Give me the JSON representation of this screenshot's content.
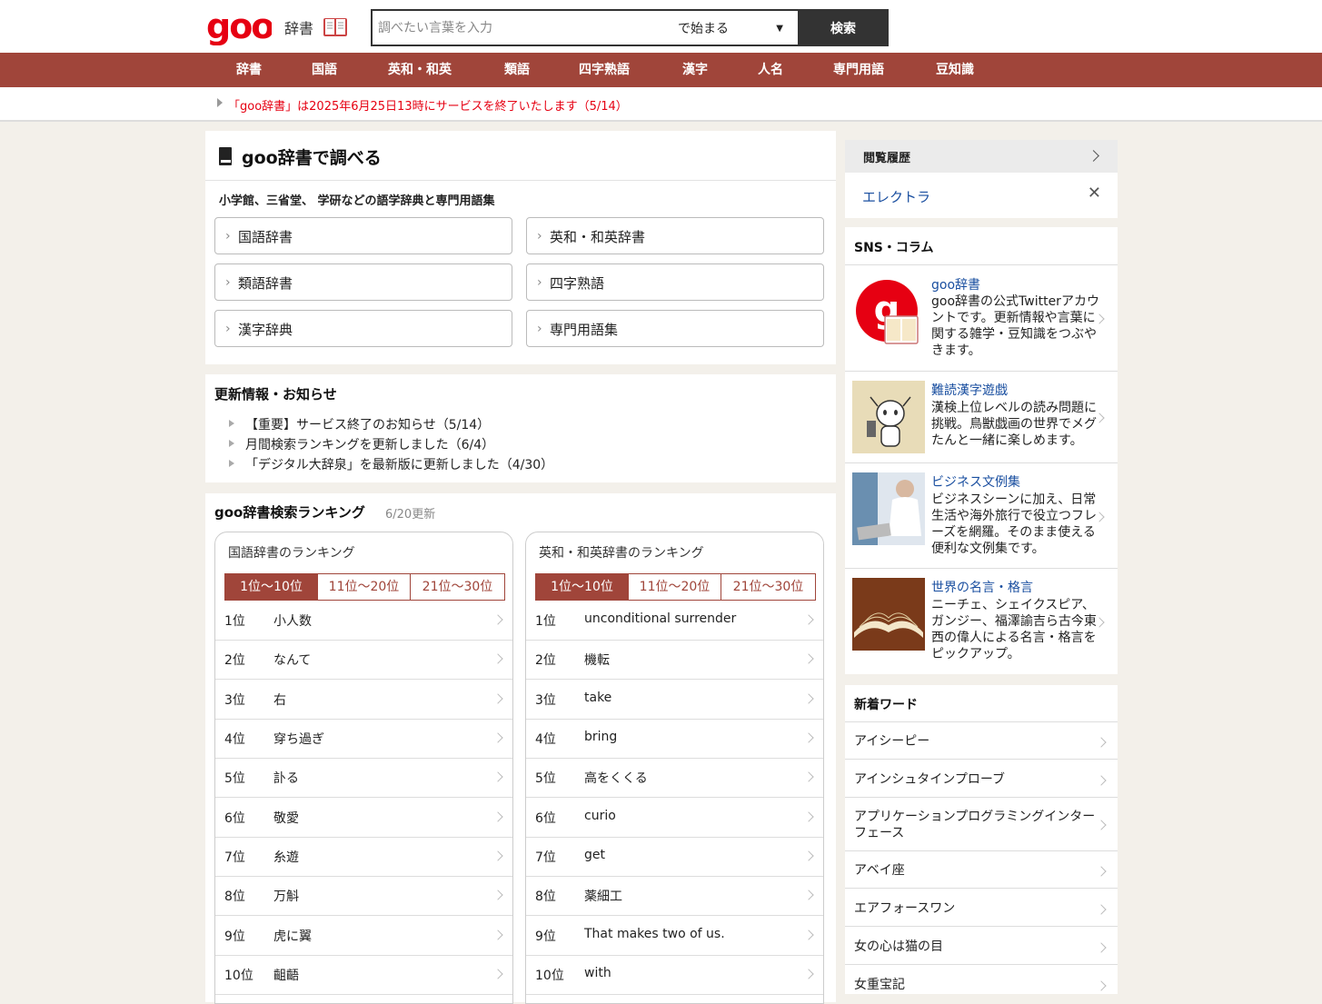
{
  "header": {
    "logo_text": "goo",
    "site_name": "辞書",
    "search": {
      "placeholder": "調べたい言葉を入力",
      "mode": "で始まる",
      "button": "検索"
    }
  },
  "nav": [
    "辞書",
    "国語",
    "英和・和英",
    "類語",
    "四字熟語",
    "漢字",
    "人名",
    "専門用語",
    "豆知識"
  ],
  "notice": "「goo辞書」は2025年6月25日13時にサービスを終了いたします（5/14）",
  "lookup": {
    "title": "goo辞書で調べる",
    "subtitle": "小学館、三省堂、 学研などの語学辞典と専門用語集",
    "dicts": [
      "国語辞書",
      "英和・和英辞書",
      "類語辞書",
      "四字熟語",
      "漢字辞典",
      "専門用語集"
    ]
  },
  "news": {
    "title": "更新情報・お知らせ",
    "items": [
      "【重要】サービス終了のお知らせ（5/14）",
      "月間検索ランキングを更新しました（6/4）",
      "「デジタル大辞泉」を最新版に更新しました（4/30）"
    ]
  },
  "ranking": {
    "title": "goo辞書検索ランキング",
    "updated": "6/20更新",
    "tabs": [
      "1位〜10位",
      "11位〜20位",
      "21位〜30位"
    ],
    "ranks": [
      "1位",
      "2位",
      "3位",
      "4位",
      "5位",
      "6位",
      "7位",
      "8位",
      "9位",
      "10位"
    ],
    "kokugo": {
      "title": "国語辞書のランキング",
      "words": [
        "小人数",
        "なんて",
        "右",
        "穿ち過ぎ",
        "訃る",
        "敬愛",
        "糸遊",
        "万斛",
        "虎に翼",
        "齟齬"
      ]
    },
    "eiwa": {
      "title": "英和・和英辞書のランキング",
      "words": [
        "unconditional surrender",
        "機転",
        "take",
        "bring",
        "高をくくる",
        "curio",
        "get",
        "薬細工",
        "That makes two of us.",
        "with"
      ]
    }
  },
  "sidebar": {
    "history_title": "閲覧履歴",
    "history_word": "エレクトラ",
    "history_close": "✕",
    "sns_title": "SNS・コラム",
    "sns": [
      {
        "name": "goo辞書",
        "desc": "goo辞書の公式Twitterアカウントです。更新情報や言葉に関する雑学・豆知識をつぶやきます。"
      },
      {
        "name": "難読漢字遊戯",
        "desc": "漢検上位レベルの読み問題に挑戦。鳥獣戯画の世界でメグたんと一緒に楽しめます。"
      },
      {
        "name": "ビジネス文例集",
        "desc": "ビジネスシーンに加え、日常生活や海外旅行で役立つフレーズを網羅。そのまま使える便利な文例集です。"
      },
      {
        "name": "世界の名言・格言",
        "desc": "ニーチェ、シェイクスピア、ガンジー、福澤諭吉ら古今東西の偉人による名言・格言をピックアップ。"
      }
    ],
    "new_words_title": "新着ワード",
    "new_words": [
      "アイシーピー",
      "アインシュタインプローブ",
      "アプリケーションプログラミングインターフェース",
      "アベイ座",
      "エアフォースワン",
      "女の心は猫の目",
      "女重宝記"
    ]
  },
  "colors": {
    "brand": "#a0453a",
    "notice": "#e60012",
    "link": "#1a4fa0"
  }
}
